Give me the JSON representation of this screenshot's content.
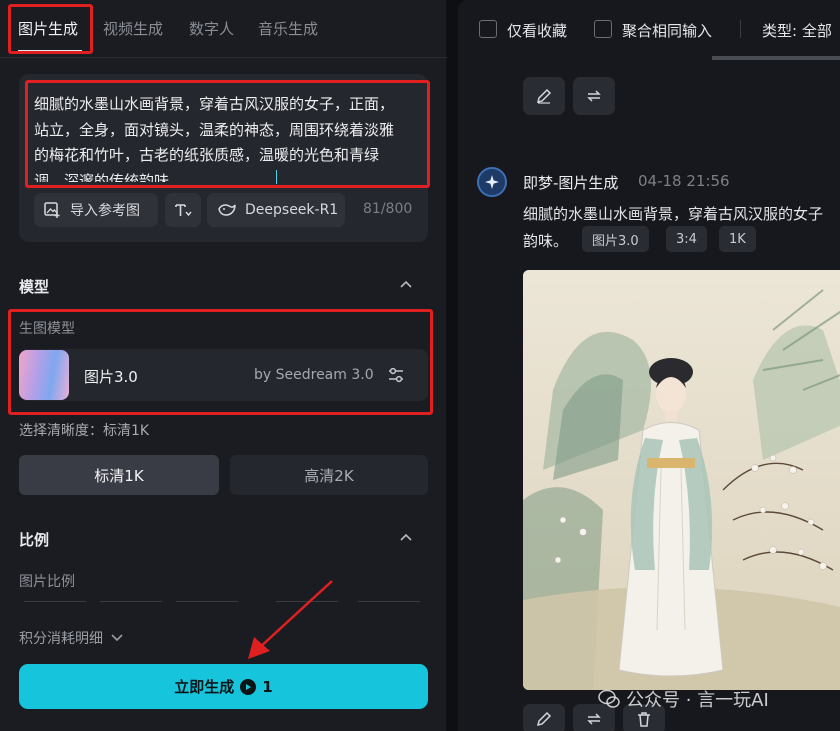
{
  "tabs": [
    {
      "label": "图片生成",
      "active": true
    },
    {
      "label": "视频生成"
    },
    {
      "label": "数字人"
    },
    {
      "label": "音乐生成"
    }
  ],
  "prompt": {
    "text": "细腻的水墨山水画背景，穿着古风汉服的女子，正面，站立，全身，面对镜头，温柔的神态，周围环绕着淡雅的梅花和竹叶，古老的纸张质感，温暖的光色和青绿调，深邃的传统韵味",
    "counter": "81/800",
    "import_ref_label": "导入参考图",
    "deepseek_label": "Deepseek-R1"
  },
  "model_section": {
    "title": "模型",
    "sub_label": "生图模型",
    "model_name": "图片3.0",
    "model_by": "by Seedream 3.0"
  },
  "resolution": {
    "label": "选择清晰度：标清1K",
    "options": [
      "标清1K",
      "高清2K"
    ],
    "selected": "标清1K"
  },
  "ratio_section": {
    "title": "比例",
    "sub_label": "图片比例"
  },
  "cost_label": "积分消耗明细",
  "generate": {
    "label": "立即生成",
    "cost": "1"
  },
  "right_toolbar": {
    "favorites_label": "仅看收藏",
    "merge_label": "聚合相同输入",
    "type_label": "类型: 全部"
  },
  "message": {
    "sender": "即梦-图片生成",
    "time": "04-18  21:56",
    "text_line1": "细腻的水墨山水画背景，穿着古风汉服的女子",
    "text_line2": "韵味。",
    "tags": [
      "图片3.0",
      "3:4",
      "1K"
    ]
  },
  "watermark": "公众号 · 言一玩AI",
  "colors": {
    "accent": "#16c5dc",
    "highlight_box": "#e02020",
    "panel_bg": "#1a1c22"
  }
}
